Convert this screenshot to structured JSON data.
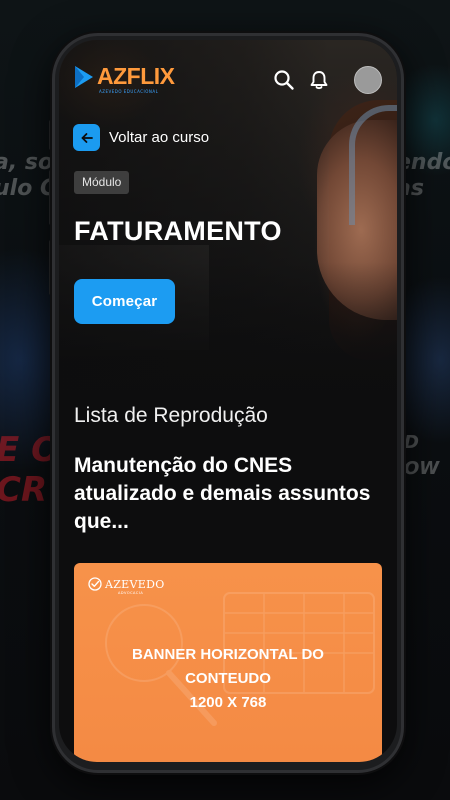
{
  "app": {
    "brand": "AZFLIX",
    "brand_tagline": "AZEVEDO EDUCACIONAL",
    "accent_color": "#1c9cf2",
    "brand_color": "#ff9a3c"
  },
  "header": {
    "icons": [
      "search-icon",
      "bell-icon"
    ],
    "avatar": "user-avatar"
  },
  "navigation": {
    "back_label": "Voltar ao curso"
  },
  "module": {
    "badge": "Módulo",
    "title": "FATURAMENTO",
    "start_label": "Começar"
  },
  "playlist": {
    "heading": "Lista de Reprodução",
    "lesson_title": "Manutenção do CNES atualizado e demais assuntos que..."
  },
  "banner": {
    "logo_text": "AZEVEDO",
    "logo_sub": "ADVOCACIA",
    "line1": "BANNER HORIZONTAL DO",
    "line2": "CONTEUDO",
    "line3": "1200 X 768",
    "color": "#f7924a"
  }
}
